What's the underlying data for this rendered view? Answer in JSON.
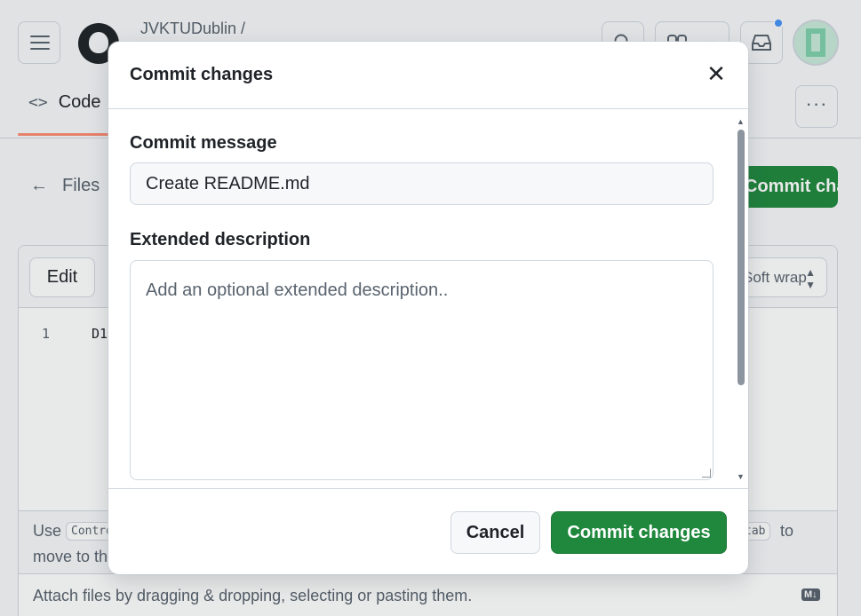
{
  "header": {
    "owner": "JVKTUDublin /",
    "code_tab": "Code",
    "code_tab_icon": "<>",
    "more_icon": "···"
  },
  "breadcrumb": {
    "back_icon": "←",
    "files_label": "Files",
    "commit_button_partial": "Commit changes..."
  },
  "editor": {
    "edit_tab": "Edit",
    "wrap_select_value": "Soft wrap",
    "line_numbers": [
      "1"
    ],
    "lines": [
      "D1"
    ],
    "hint_use": "Use",
    "hint_ctrl_key": "Control + Shift + m",
    "hint_tab_key": "tab",
    "hint_to": "to",
    "hint_move": "move to the next element.",
    "attach_text": "Attach files by dragging & dropping, selecting or pasting them.",
    "markdown_badge": "M↓"
  },
  "dialog": {
    "title": "Commit changes",
    "close_icon": "✕",
    "commit_message_label": "Commit message",
    "commit_message_value": "Create README.md",
    "extended_description_label": "Extended description",
    "extended_description_placeholder": "Add an optional extended description..",
    "cancel_label": "Cancel",
    "commit_label": "Commit changes"
  },
  "colors": {
    "primary_green": "#1f883d",
    "tab_underline": "#fd8c73",
    "notification_dot": "#4493f8",
    "border": "#d0d7de"
  }
}
